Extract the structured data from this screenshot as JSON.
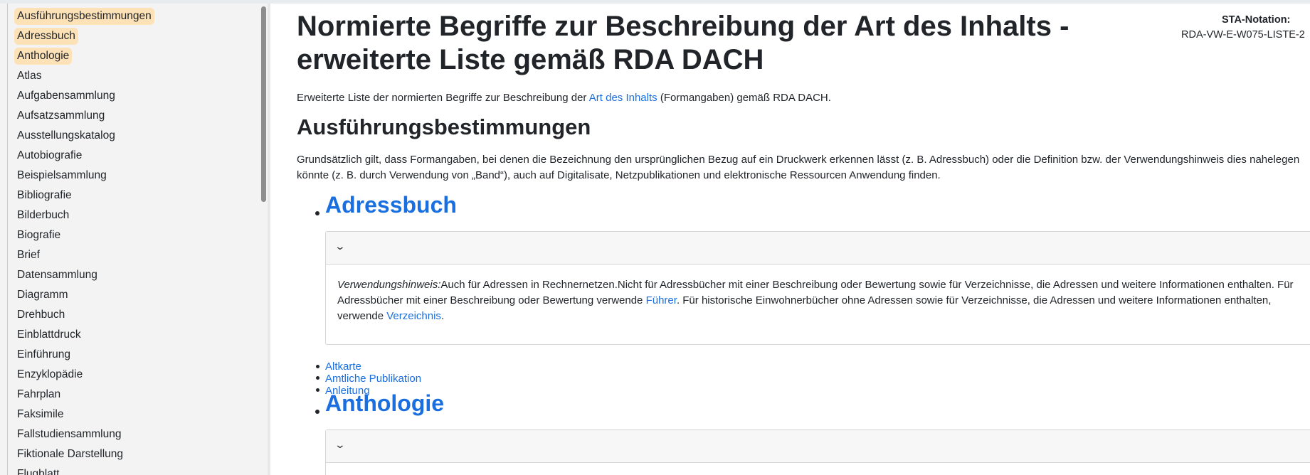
{
  "sidebar": {
    "items": [
      {
        "label": "Ausführungsbestimmungen",
        "highlighted": true
      },
      {
        "label": "Adressbuch",
        "highlighted": true
      },
      {
        "label": "Anthologie",
        "highlighted": true
      },
      {
        "label": "Atlas"
      },
      {
        "label": "Aufgabensammlung"
      },
      {
        "label": "Aufsatzsammlung"
      },
      {
        "label": "Ausstellungskatalog"
      },
      {
        "label": "Autobiografie"
      },
      {
        "label": "Beispielsammlung"
      },
      {
        "label": "Bibliografie"
      },
      {
        "label": "Bilderbuch"
      },
      {
        "label": "Biografie"
      },
      {
        "label": "Brief"
      },
      {
        "label": "Datensammlung"
      },
      {
        "label": "Diagramm"
      },
      {
        "label": "Drehbuch"
      },
      {
        "label": "Einblattdruck"
      },
      {
        "label": "Einführung"
      },
      {
        "label": "Enzyklopädie"
      },
      {
        "label": "Fahrplan"
      },
      {
        "label": "Faksimile"
      },
      {
        "label": "Fallstudiensammlung"
      },
      {
        "label": "Fiktionale Darstellung"
      },
      {
        "label": "Flugblatt"
      }
    ]
  },
  "page": {
    "title": "Normierte Begriffe zur Beschreibung der Art des Inhalts - erweiterte Liste gemäß RDA DACH",
    "sta_label": "STA-Notation:",
    "sta_value": "RDA-VW-E-W075-LISTE-2",
    "intro_before": "Erweiterte Liste der normierten Begriffe zur Beschreibung der ",
    "intro_link": "Art des Inhalts",
    "intro_after": " (Formangaben) gemäß RDA DACH.",
    "section_title": "Ausführungsbestimmungen",
    "section_text": "Grundsätzlich gilt, dass Formangaben, bei denen die Bezeichnung den ursprünglichen Bezug auf ein Druckwerk erkennen lässt (z. B. Adressbuch) oder die Definition bzw. der Verwendungshinweis dies nahelegen könnte (z. B. durch Verwendung von „Band“), auch auf Digitalisate, Netzpublikationen und elektronische Ressourcen Anwendung finden."
  },
  "terms": {
    "adressbuch": {
      "title": "Adressbuch",
      "hint_label": "Verwendungshinweis:",
      "hint_text_1": "Auch für Adressen in Rechnernetzen.Nicht für Adressbücher mit einer Beschreibung oder Bewertung sowie für Verzeichnisse, die Adressen und weitere Informationen enthalten. Für Adressbücher mit einer Beschreibung oder Bewertung verwende ",
      "hint_link_1": "Führer",
      "hint_text_2": ". Für historische Einwohnerbücher ohne Adressen sowie für Verzeichnisse, die Adressen und weitere Informationen enthalten, verwende ",
      "hint_link_2": "Verzeichnis",
      "hint_text_3": "."
    },
    "related": [
      "Altkarte",
      "Amtliche Publikation",
      "Anleitung"
    ],
    "anthologie": {
      "title": "Anthologie"
    }
  },
  "icons": {
    "accordion_toggle": "chevron-down-icon"
  },
  "colors": {
    "link": "#1a6fe0",
    "highlight": "#fde2b8",
    "sidebar_bg": "#f3f3f3"
  }
}
